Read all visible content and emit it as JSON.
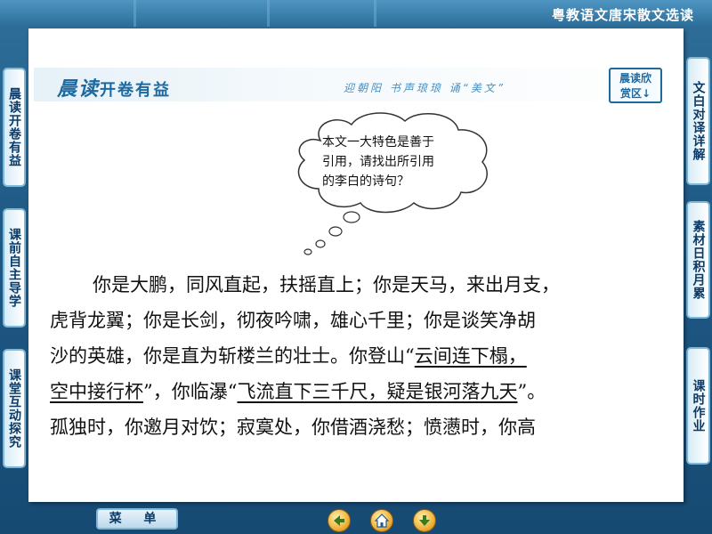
{
  "header": {
    "title": "粤教语文唐宋散文选读"
  },
  "left_tabs": [
    {
      "label": "晨读开卷有益"
    },
    {
      "label": "课前自主导学"
    },
    {
      "label": "课堂互动探究"
    }
  ],
  "right_tabs": [
    {
      "label": "文白对译详解"
    },
    {
      "label": "素材日积月累"
    },
    {
      "label": "课时作业"
    }
  ],
  "banner": {
    "title_part1": "晨读",
    "title_part2": "开卷有益",
    "subtitle": "迎朝阳  书声琅琅  诵“美文”",
    "button_line1": "晨读欣",
    "button_line2": "赏区↓"
  },
  "bubble": {
    "line1": "本文一大特色是善于",
    "line2": "引用，请找出所引用",
    "line3": "的李白的诗句？"
  },
  "body": {
    "p1": "你是大鹏，同风直起，扶摇直上；你是天马，来出月支，",
    "p2": "虎背龙翼；你是长剑，彻夜吟啸，雄心千里；你是谈笑净胡",
    "p3a": "沙的英雄，你是直为斩楼兰的壮士。你登山“",
    "p3u": "云间连下榻，",
    "p4u": "空中接行杯",
    "p4a": "”，你临瀑“",
    "p4u2": "飞流直下三千尺，疑是银河落九天",
    "p4b": "”。",
    "p5": "孤独时，你邀月对饮；寂寞处，你借酒浇愁；愤懑时，你高"
  },
  "footer": {
    "menu_label": "菜 单"
  },
  "icons": [
    "back-arrow-icon",
    "home-icon",
    "forward-arrow-icon"
  ]
}
